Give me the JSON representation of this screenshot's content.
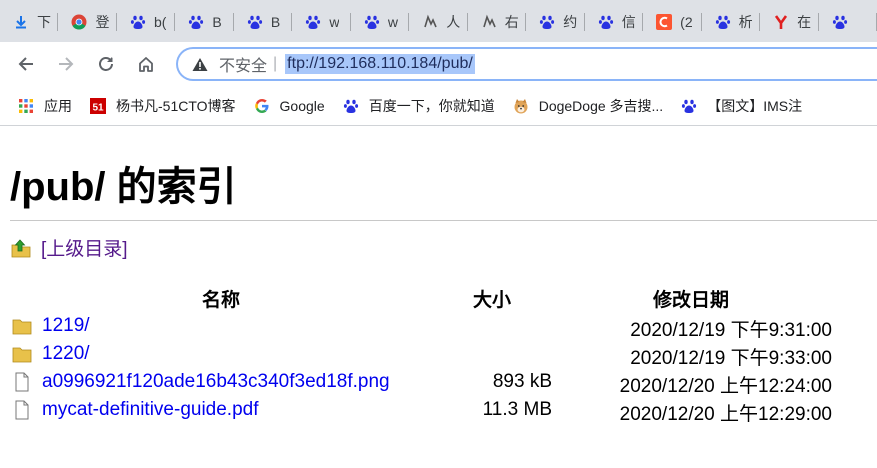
{
  "tabs": [
    {
      "title": "下",
      "icon": "download-icon"
    },
    {
      "title": "登",
      "icon": "chrome-icon"
    },
    {
      "title": "b(",
      "icon": "baidu-paw-icon"
    },
    {
      "title": "B",
      "icon": "baidu-paw-icon"
    },
    {
      "title": "B",
      "icon": "baidu-paw-icon"
    },
    {
      "title": "w",
      "icon": "baidu-paw-icon"
    },
    {
      "title": "w",
      "icon": "baidu-paw-icon"
    },
    {
      "title": "人",
      "icon": "script-icon"
    },
    {
      "title": "右",
      "icon": "script-icon"
    },
    {
      "title": "约",
      "icon": "baidu-paw-icon"
    },
    {
      "title": "信",
      "icon": "baidu-paw-icon"
    },
    {
      "title": "(2",
      "icon": "csdn-icon"
    },
    {
      "title": "析",
      "icon": "baidu-paw-icon"
    },
    {
      "title": "在",
      "icon": "y-icon"
    },
    {
      "title": "",
      "icon": "baidu-paw-icon"
    }
  ],
  "toolbar": {
    "back_icon": "back-arrow-icon",
    "forward_icon": "forward-arrow-icon",
    "reload_icon": "reload-icon",
    "home_icon": "home-icon"
  },
  "omnibox": {
    "security_label": "不安全",
    "separator": "|",
    "url": "ftp://192.168.110.184/pub/"
  },
  "bookmarks": [
    {
      "label": "应用",
      "icon": "apps-grid-icon"
    },
    {
      "label": "杨书凡-51CTO博客",
      "icon": "51cto-icon"
    },
    {
      "label": "Google",
      "icon": "google-icon"
    },
    {
      "label": "百度一下，你就知道",
      "icon": "baidu-paw-icon"
    },
    {
      "label": "DogeDoge 多吉搜...",
      "icon": "doge-icon"
    },
    {
      "label": "【图文】IMS注",
      "icon": "baidu-paw-icon"
    }
  ],
  "page": {
    "title": "/pub/ 的索引",
    "parent_link": "[上级目录]",
    "columns": {
      "name": "名称",
      "size": "大小",
      "date": "修改日期"
    },
    "entries": [
      {
        "name": "1219/",
        "size": "",
        "date": "2020/12/19 下午9:31:00",
        "type": "folder"
      },
      {
        "name": "1220/",
        "size": "",
        "date": "2020/12/19 下午9:33:00",
        "type": "folder"
      },
      {
        "name": "a0996921f120ade16b43c340f3ed18f.png",
        "size": "893 kB",
        "date": "2020/12/20 上午12:24:00",
        "type": "file"
      },
      {
        "name": "mycat-definitive-guide.pdf",
        "size": "11.3 MB",
        "date": "2020/12/20 上午12:29:00",
        "type": "file"
      }
    ]
  },
  "colors": {
    "tabstrip_bg": "#dee1e6",
    "link_unvisited": "#0000ee",
    "link_visited": "#551a8b",
    "url_highlight": "#a8c7fa",
    "omnibox_border": "#8ab4f8"
  }
}
